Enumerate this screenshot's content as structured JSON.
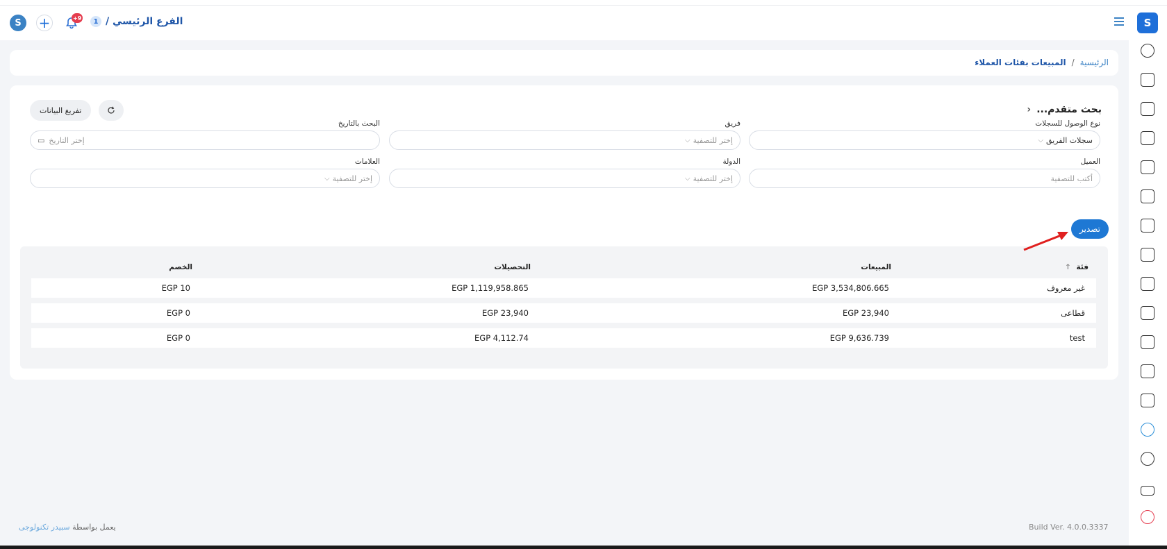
{
  "header": {
    "branch_label": "الفرع الرئيسي /",
    "branch_number": "1",
    "notification_count": "+9"
  },
  "breadcrumb": {
    "home": "الرئيسية",
    "separator": "/",
    "current": "المبيعات بفئات العملاء"
  },
  "search": {
    "title": "بحث متقدم...",
    "clear_label": "تفريغ البيانات",
    "fields": {
      "access_type": {
        "label": "نوع الوصول للسجلات",
        "value": "سجلات الفريق"
      },
      "team": {
        "label": "فريق",
        "placeholder": "إختر للتصفية"
      },
      "date": {
        "label": "البحث بالتاريخ",
        "placeholder": "إختر التاريخ"
      },
      "customer": {
        "label": "العميل",
        "placeholder": "أكتب للتصفية"
      },
      "country": {
        "label": "الدولة",
        "placeholder": "إختر للتصفية"
      },
      "tags": {
        "label": "العلامات",
        "placeholder": "إختر للتصفية"
      }
    }
  },
  "export_label": "تصدير",
  "table": {
    "columns": {
      "category": "فئة",
      "sales": "المبيعات",
      "collections": "التحصيلات",
      "discount": "الخصم"
    },
    "rows": [
      {
        "category": "غير معروف",
        "sales": "EGP 3,534,806.665",
        "collections": "EGP 1,119,958.865",
        "discount": "EGP 10"
      },
      {
        "category": "قطاعى",
        "sales": "EGP 23,940",
        "collections": "EGP 23,940",
        "discount": "EGP 0"
      },
      {
        "category": "test",
        "sales": "EGP 9,636.739",
        "collections": "EGP 4,112.74",
        "discount": "EGP 0"
      }
    ]
  },
  "footer": {
    "powered_by": "يعمل بواسطة",
    "company": "سبيدر تكنولوجى",
    "build": "Build Ver. 4.0.0.3337"
  },
  "colors": {
    "accent": "#1e78d4",
    "danger": "#e53d4f",
    "brand": "#3b82c4"
  }
}
